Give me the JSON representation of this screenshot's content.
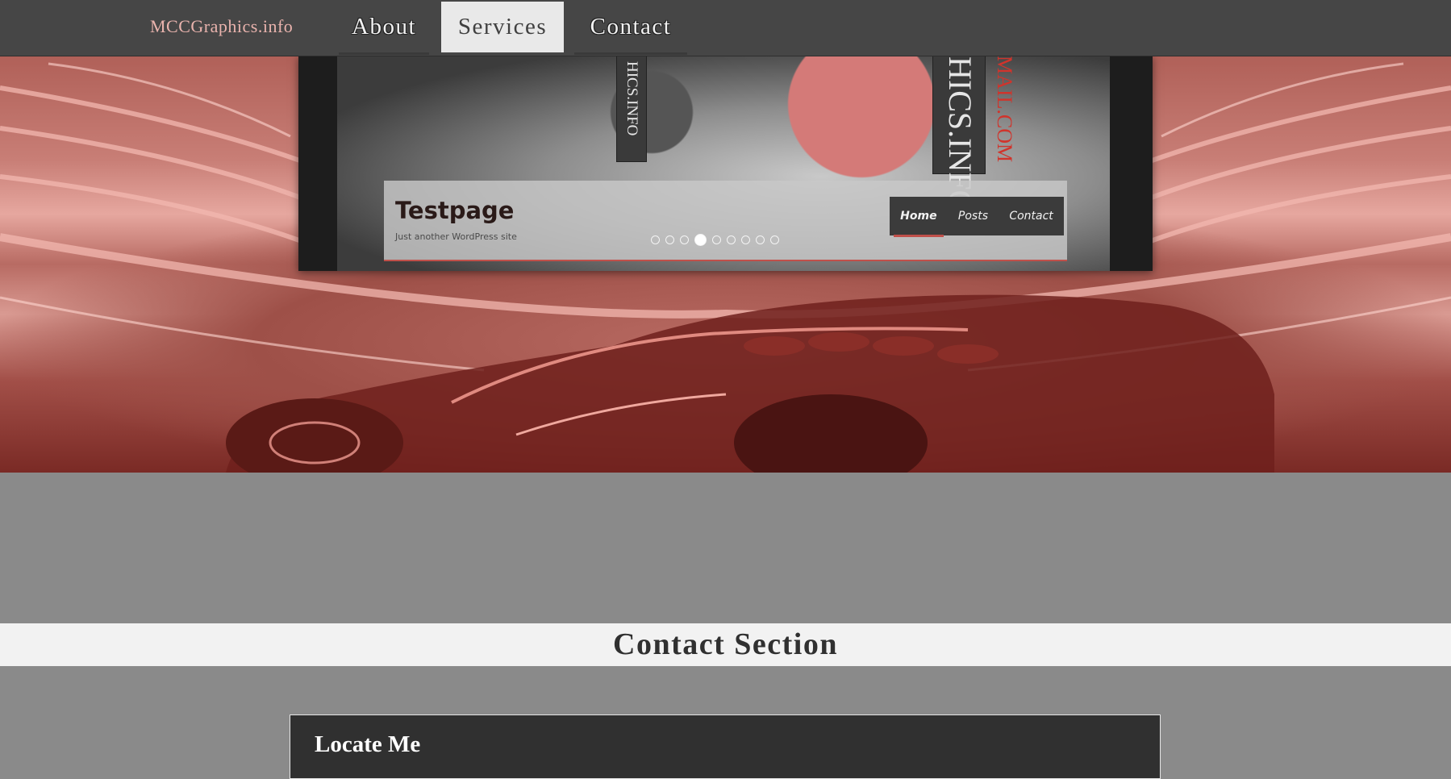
{
  "navbar": {
    "brand": "MCCGraphics.info",
    "links": [
      {
        "label": "About",
        "active": false
      },
      {
        "label": "Services",
        "active": true
      },
      {
        "label": "Contact",
        "active": false
      }
    ]
  },
  "slider": {
    "vertical_texts": [
      "HICS.INFO",
      "HICS.INFO",
      "MAIL.COM"
    ],
    "site_title": "Testpage",
    "tagline": "Just another WordPress site",
    "menu": [
      {
        "label": "Home",
        "active": true
      },
      {
        "label": "Posts",
        "active": false
      },
      {
        "label": "Contact",
        "active": false
      }
    ],
    "slides": {
      "count": 9,
      "active_index": 3
    }
  },
  "contact": {
    "section_title": "Contact Section",
    "locate_title": "Locate Me"
  },
  "colors": {
    "nav_bg": "#464646",
    "brand": "#e9b3ad",
    "page_bg": "#8a8a8a",
    "accent_red": "#c0504a",
    "contact_band": "#f2f2f2",
    "locate_box": "#303030"
  }
}
